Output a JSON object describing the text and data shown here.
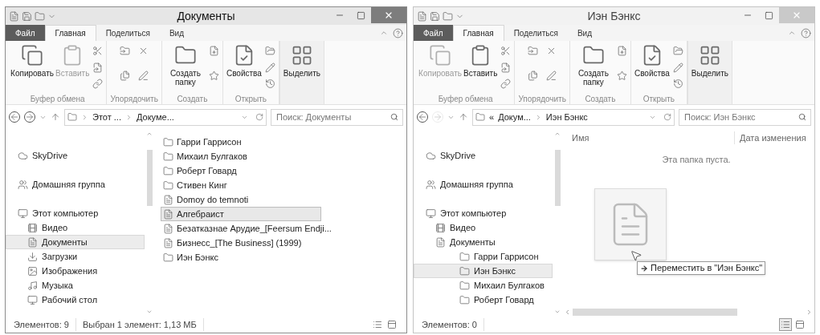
{
  "windows": [
    {
      "title": "Документы",
      "active": true,
      "tabs": [
        {
          "label": "Файл",
          "kind": "file",
          "selected": false
        },
        {
          "label": "Главная",
          "kind": "tab",
          "selected": true
        },
        {
          "label": "Поделиться",
          "kind": "tab",
          "selected": false
        },
        {
          "label": "Вид",
          "kind": "tab",
          "selected": false
        }
      ],
      "ribbon": [
        {
          "label": "Буфер обмена",
          "kind": "clipboard",
          "buttons": [
            {
              "label": "Копировать",
              "kind": "copy",
              "disabled": false
            },
            {
              "label": "Вставить",
              "kind": "paste",
              "disabled": true
            }
          ]
        },
        {
          "label": "Упорядочить",
          "kind": "organize"
        },
        {
          "label": "Создать",
          "kind": "new",
          "buttons": [
            {
              "label": "Создать папку",
              "kind": "new-folder",
              "disabled": false
            }
          ]
        },
        {
          "label": "Открыть",
          "kind": "open",
          "buttons": [
            {
              "label": "Свойства",
              "kind": "properties",
              "disabled": false
            }
          ]
        },
        {
          "kind": "select",
          "buttons": [
            {
              "label": "Выделить",
              "kind": "select",
              "disabled": false
            }
          ]
        }
      ],
      "nav": {
        "back_enabled": true,
        "forward_enabled": true,
        "crumbs": [
          "Этот ...",
          "Докуме..."
        ]
      },
      "search": {
        "placeholder": "Поиск: Документы"
      },
      "sidebar": [
        {
          "label": "SkyDrive",
          "kind": "cloud",
          "selected": false
        },
        {
          "label": "Домашняя группа",
          "kind": "homegroup",
          "selected": false
        },
        {
          "label": "Этот компьютер",
          "kind": "computer",
          "selected": false,
          "children": [
            {
              "label": "Видео",
              "kind": "video",
              "selected": false
            },
            {
              "label": "Документы",
              "kind": "documents",
              "selected": true
            },
            {
              "label": "Загрузки",
              "kind": "downloads",
              "selected": false
            },
            {
              "label": "Изображения",
              "kind": "pictures",
              "selected": false
            },
            {
              "label": "Музыка",
              "kind": "music",
              "selected": false
            },
            {
              "label": "Рабочий стол",
              "kind": "desktop",
              "selected": false
            }
          ]
        }
      ],
      "content": {
        "kind": "list",
        "items": [
          {
            "name": "Гарри Гаррисон",
            "kind": "folder",
            "selected": false
          },
          {
            "name": "Михаил Булгаков",
            "kind": "folder",
            "selected": false
          },
          {
            "name": "Роберт Говард",
            "kind": "folder",
            "selected": false
          },
          {
            "name": "Стивен Кинг",
            "kind": "folder",
            "selected": false
          },
          {
            "name": "Domoy do temnoti",
            "kind": "file",
            "selected": false
          },
          {
            "name": "Алгебраист",
            "kind": "file",
            "selected": true
          },
          {
            "name": "Безатказнае Арудие_[Feersum Endji...",
            "kind": "file",
            "selected": false
          },
          {
            "name": "Бизнесс_[The Business] (1999)",
            "kind": "file",
            "selected": false
          },
          {
            "name": "Иэн Бэнкс",
            "kind": "folder",
            "selected": false
          }
        ]
      },
      "status": {
        "items": "Элементов: 9",
        "selection": "Выбран 1 элемент: 1,13 МБ",
        "views": [
          {
            "kind": "details",
            "selected": false
          },
          {
            "kind": "tiles",
            "selected": false
          }
        ]
      }
    },
    {
      "title": "Иэн Бэнкс",
      "active": false,
      "tabs": [
        {
          "label": "Файл",
          "kind": "file",
          "selected": false
        },
        {
          "label": "Главная",
          "kind": "tab",
          "selected": true
        },
        {
          "label": "Поделиться",
          "kind": "tab",
          "selected": false
        },
        {
          "label": "Вид",
          "kind": "tab",
          "selected": false
        }
      ],
      "ribbon": [
        {
          "label": "Буфер обмена",
          "kind": "clipboard",
          "buttons": [
            {
              "label": "Копировать",
              "kind": "copy",
              "disabled": true
            },
            {
              "label": "Вставить",
              "kind": "paste",
              "disabled": false
            }
          ]
        },
        {
          "label": "Упорядочить",
          "kind": "organize"
        },
        {
          "label": "Создать",
          "kind": "new",
          "buttons": [
            {
              "label": "Создать папку",
              "kind": "new-folder",
              "disabled": false
            }
          ]
        },
        {
          "label": "Открыть",
          "kind": "open",
          "buttons": [
            {
              "label": "Свойства",
              "kind": "properties",
              "disabled": false
            }
          ]
        },
        {
          "kind": "select",
          "buttons": [
            {
              "label": "Выделить",
              "kind": "select",
              "disabled": false
            }
          ]
        }
      ],
      "nav": {
        "back_enabled": true,
        "forward_enabled": false,
        "overflow": "«",
        "crumbs": [
          "Докум...",
          "Иэн Бэнкс"
        ]
      },
      "search": {
        "placeholder": "Поиск: Иэн Бэнкс"
      },
      "sidebar": [
        {
          "label": "SkyDrive",
          "kind": "cloud",
          "selected": false
        },
        {
          "label": "Домашняя группа",
          "kind": "homegroup",
          "selected": false
        },
        {
          "label": "Этот компьютер",
          "kind": "computer",
          "selected": false,
          "children": [
            {
              "label": "Видео",
              "kind": "video",
              "selected": false
            },
            {
              "label": "Документы",
              "kind": "documents",
              "selected": false,
              "children": [
                {
                  "label": "Гарри Гаррисон",
                  "kind": "folder",
                  "selected": false
                },
                {
                  "label": "Иэн Бэнкс",
                  "kind": "folder",
                  "selected": true
                },
                {
                  "label": "Михаил Булгаков",
                  "kind": "folder",
                  "selected": false
                },
                {
                  "label": "Роберт Говард",
                  "kind": "folder",
                  "selected": false
                }
              ]
            }
          ]
        }
      ],
      "content": {
        "kind": "details",
        "columns": [
          "Имя",
          "Дата изменения"
        ],
        "empty_text": "Эта папка пуста.",
        "drag_tooltip": "Переместить в \"Иэн Бэнкс\""
      },
      "status": {
        "items": "Элементов: 0",
        "views": [
          {
            "kind": "details",
            "selected": true
          },
          {
            "kind": "tiles",
            "selected": false
          }
        ]
      }
    }
  ]
}
